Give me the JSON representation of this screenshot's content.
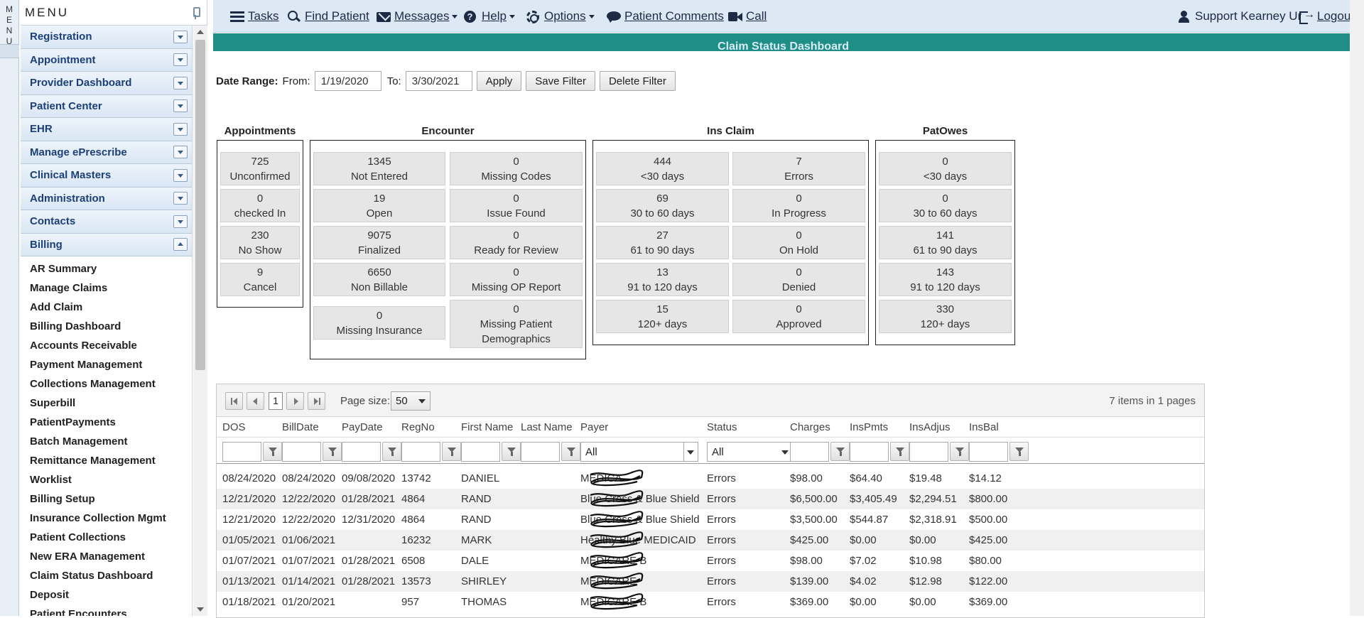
{
  "sidebar": {
    "vertical_label": "MENU",
    "title": "MENU",
    "groups": [
      {
        "label": "Registration"
      },
      {
        "label": "Appointment"
      },
      {
        "label": "Provider Dashboard"
      },
      {
        "label": "Patient Center"
      },
      {
        "label": "EHR"
      },
      {
        "label": "Manage ePrescribe"
      },
      {
        "label": "Clinical Masters"
      },
      {
        "label": "Administration"
      },
      {
        "label": "Contacts"
      },
      {
        "label": "Billing"
      }
    ],
    "billing_items": [
      "AR Summary",
      "Manage Claims",
      "Add Claim",
      "Billing Dashboard",
      "Accounts Receivable",
      "Payment Management",
      "Collections Management",
      "Superbill",
      "PatientPayments",
      "Batch Management",
      "Remittance Management",
      "Worklist",
      "Billing Setup",
      "Insurance Collection Mgmt",
      "Patient Collections",
      "New ERA Management",
      "Claim Status Dashboard",
      "Deposit",
      "Patient Encounters"
    ]
  },
  "topbar": {
    "tasks": "Tasks",
    "find_patient": "Find Patient",
    "messages": "Messages",
    "help": "Help",
    "options": "Options",
    "patient_comments": "Patient Comments",
    "call": "Call",
    "user": "Support Kearney Ur",
    "logout": "Logout"
  },
  "page_title": "Claim Status Dashboard",
  "filter": {
    "date_range_label": "Date Range:",
    "from_label": "From:",
    "from_value": "1/19/2020",
    "to_label": "To:",
    "to_value": "3/30/2021",
    "apply": "Apply",
    "save_filter": "Save Filter",
    "delete_filter": "Delete Filter"
  },
  "panels": {
    "appointments": {
      "title": "Appointments",
      "stats": [
        {
          "value": "725",
          "label": "Unconfirmed"
        },
        {
          "value": "0",
          "label": "checked In"
        },
        {
          "value": "230",
          "label": "No Show"
        },
        {
          "value": "9",
          "label": "Cancel"
        }
      ]
    },
    "encounter": {
      "title": "Encounter",
      "left": [
        {
          "value": "1345",
          "label": "Not Entered"
        },
        {
          "value": "19",
          "label": "Open"
        },
        {
          "value": "9075",
          "label": "Finalized"
        },
        {
          "value": "6650",
          "label": "Non Billable"
        },
        {
          "value": "0",
          "label": "Missing Insurance"
        }
      ],
      "right": [
        {
          "value": "0",
          "label": "Missing Codes"
        },
        {
          "value": "0",
          "label": "Issue Found"
        },
        {
          "value": "0",
          "label": "Ready for Review"
        },
        {
          "value": "0",
          "label": "Missing OP Report"
        },
        {
          "value": "0",
          "label": "Missing Patient Demographics"
        }
      ]
    },
    "ins_claim": {
      "title": "Ins Claim",
      "left": [
        {
          "value": "444",
          "label": "<30 days"
        },
        {
          "value": "69",
          "label": "30 to 60 days"
        },
        {
          "value": "27",
          "label": "61 to 90 days"
        },
        {
          "value": "13",
          "label": "91 to 120 days"
        },
        {
          "value": "15",
          "label": "120+ days"
        }
      ],
      "right": [
        {
          "value": "7",
          "label": "Errors"
        },
        {
          "value": "0",
          "label": "In Progress"
        },
        {
          "value": "0",
          "label": "On Hold"
        },
        {
          "value": "0",
          "label": "Denied"
        },
        {
          "value": "0",
          "label": "Approved"
        }
      ]
    },
    "patowes": {
      "title": "PatOwes",
      "stats": [
        {
          "value": "0",
          "label": "<30 days"
        },
        {
          "value": "0",
          "label": "30 to 60 days"
        },
        {
          "value": "141",
          "label": "61 to 90 days"
        },
        {
          "value": "143",
          "label": "91 to 120 days"
        },
        {
          "value": "330",
          "label": "120+ days"
        }
      ]
    }
  },
  "grid": {
    "current_page": "1",
    "page_size_label": "Page size:",
    "page_size": "50",
    "pager_info": "7 items in 1 pages",
    "columns": [
      "DOS",
      "BillDate",
      "PayDate",
      "RegNo",
      "First Name",
      "Last Name",
      "Payer",
      "Status",
      "Charges",
      "InsPmts",
      "InsAdjus",
      "InsBal"
    ],
    "payer_filter": "All",
    "status_filter": "All",
    "rows": [
      {
        "dos": "08/24/2020",
        "billdate": "08/24/2020",
        "paydate": "09/08/2020",
        "regno": "13742",
        "first": "DANIEL",
        "payer": "MEDICA",
        "status": "Errors",
        "charges": "$98.00",
        "inspmts": "$64.40",
        "insadjus": "$19.48",
        "insbal": "$14.12"
      },
      {
        "dos": "12/21/2020",
        "billdate": "12/22/2020",
        "paydate": "01/28/2021",
        "regno": "4864",
        "first": "RAND",
        "payer": "Blue Cross & Blue Shield",
        "status": "Errors",
        "charges": "$6,500.00",
        "inspmts": "$3,405.49",
        "insadjus": "$2,294.51",
        "insbal": "$800.00"
      },
      {
        "dos": "12/21/2020",
        "billdate": "12/22/2020",
        "paydate": "12/31/2020",
        "regno": "4864",
        "first": "RAND",
        "payer": "Blue Cross & Blue Shield",
        "status": "Errors",
        "charges": "$3,500.00",
        "inspmts": "$544.87",
        "insadjus": "$2,318.91",
        "insbal": "$500.00"
      },
      {
        "dos": "01/05/2021",
        "billdate": "01/06/2021",
        "paydate": "",
        "regno": "16232",
        "first": "MARK",
        "payer": "Healthy Blue MEDICAID",
        "status": "Errors",
        "charges": "$425.00",
        "inspmts": "$0.00",
        "insadjus": "$0.00",
        "insbal": "$425.00"
      },
      {
        "dos": "01/07/2021",
        "billdate": "01/07/2021",
        "paydate": "01/28/2021",
        "regno": "6508",
        "first": "DALE",
        "payer": "MEDICARE B",
        "status": "Errors",
        "charges": "$98.00",
        "inspmts": "$7.02",
        "insadjus": "$10.98",
        "insbal": "$80.00"
      },
      {
        "dos": "01/13/2021",
        "billdate": "01/14/2021",
        "paydate": "01/28/2021",
        "regno": "13573",
        "first": "SHIRLEY",
        "payer": "MEDICARE",
        "status": "Errors",
        "charges": "$139.00",
        "inspmts": "$4.02",
        "insadjus": "$12.98",
        "insbal": "$122.00"
      },
      {
        "dos": "01/18/2021",
        "billdate": "01/20/2021",
        "paydate": "",
        "regno": "957",
        "first": "THOMAS",
        "payer": "MEDICARE B",
        "status": "Errors",
        "charges": "$369.00",
        "inspmts": "$0.00",
        "insadjus": "$0.00",
        "insbal": "$369.00"
      }
    ]
  }
}
